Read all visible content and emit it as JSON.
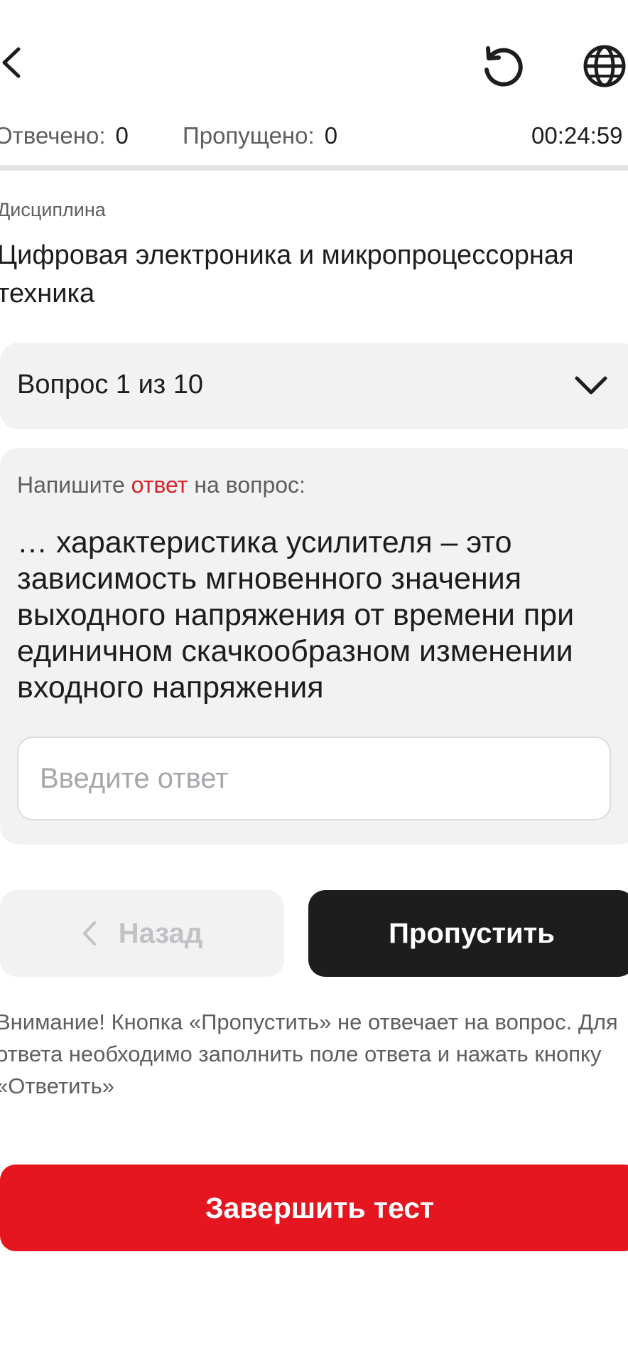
{
  "header": {
    "back_icon": "chevron-left-icon",
    "reset_icon": "refresh-icon",
    "language_icon": "globe-icon"
  },
  "stats": {
    "answered_label": "Отвечено:",
    "answered_value": "0",
    "skipped_label": "Пропущено:",
    "skipped_value": "0",
    "timer": "00:24:59"
  },
  "discipline": {
    "label": "Дисциплина",
    "name": "Цифровая электроника и микропроцессорная техника"
  },
  "question_selector": {
    "label": "Вопрос 1 из 10",
    "icon": "chevron-down-icon"
  },
  "question": {
    "instruction_before": "Напишите ",
    "instruction_accent": "ответ",
    "instruction_after": " на вопрос:",
    "text": "… характеристика усилителя – это зависимость мгновенного значения выходного напряжения от времени при единичном скачкообразном изменении входного напряжения",
    "answer_value": "",
    "answer_placeholder": "Введите ответ"
  },
  "buttons": {
    "back_label": "Назад",
    "skip_label": "Пропустить",
    "finish_label": "Завершить тест"
  },
  "warning": {
    "text": "Внимание! Кнопка «Пропустить» не отвечает на вопрос. Для ответа необходимо заполнить поле ответа и нажать кнопку «Ответить»"
  },
  "colors": {
    "accent_red": "#e5161f",
    "dark_button": "#1d1d1d",
    "card_background": "#f2f2f2",
    "text_primary": "#1d1d1f",
    "text_secondary": "#5e5e62"
  }
}
